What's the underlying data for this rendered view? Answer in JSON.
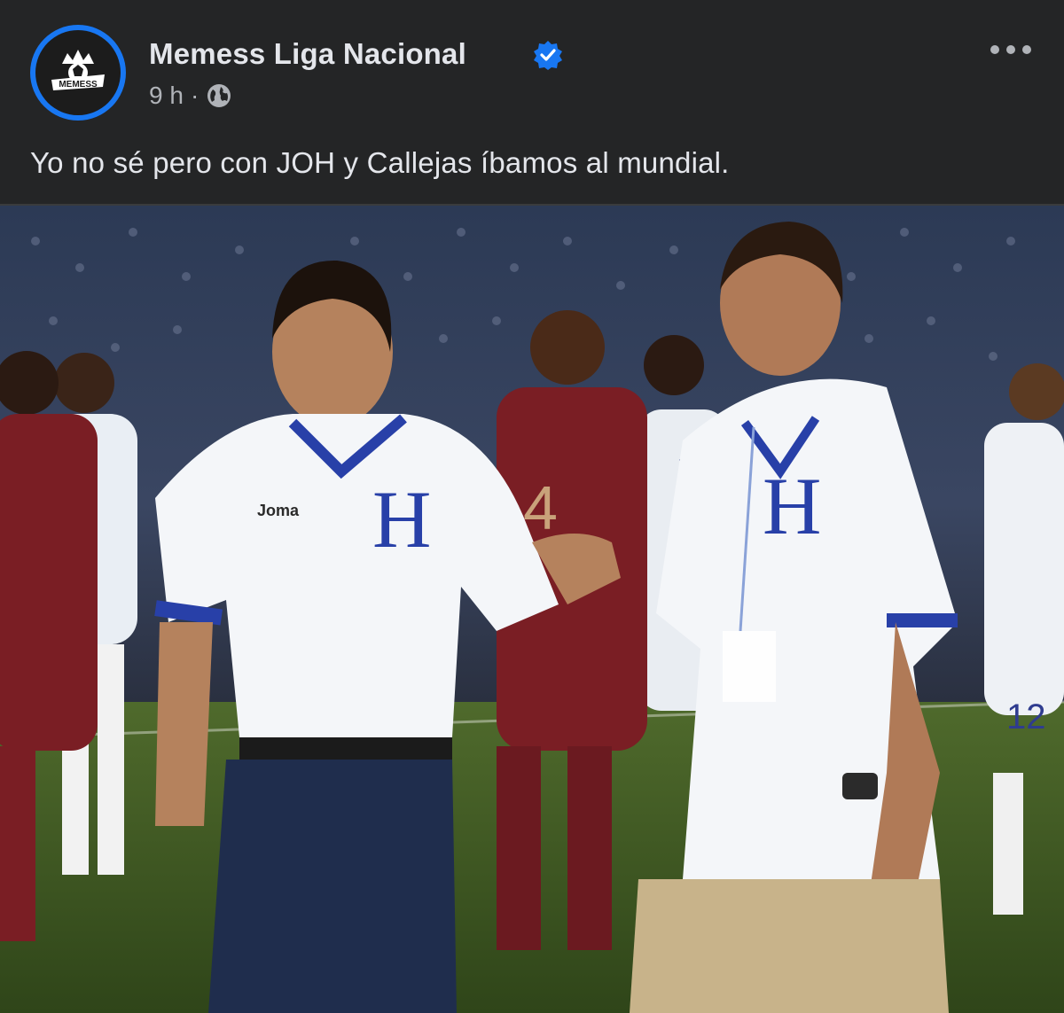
{
  "post": {
    "author": "Memess Liga Nacional",
    "avatar_text": "MEMESS",
    "verified_icon": "verified-badge-icon",
    "time": "9 h",
    "separator": "·",
    "audience_icon": "globe-icon",
    "more_icon": "more-options-icon",
    "text": "Yo no sé pero con JOH y Callejas íbamos al mundial."
  },
  "photo": {
    "jersey_brand": "Joma",
    "jersey_letter": "H",
    "player_number_1": "4",
    "player_number_2": "12"
  },
  "colors": {
    "background": "#242526",
    "accent": "#1877f2",
    "text_primary": "#e4e6eb",
    "text_secondary": "#b0b3b8"
  }
}
